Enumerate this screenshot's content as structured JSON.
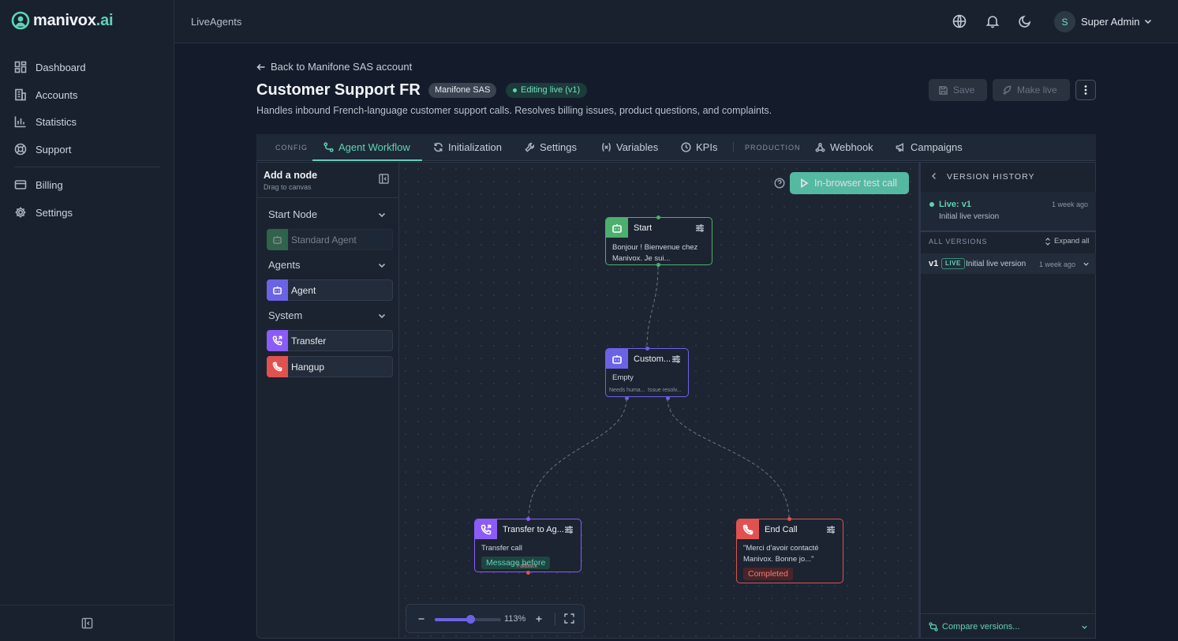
{
  "brand": {
    "name_main": "manivox",
    "name_suffix": ".ai",
    "accent": "#5fd3b6"
  },
  "sidebar": {
    "items": [
      {
        "label": "Dashboard",
        "icon": "dashboard-icon"
      },
      {
        "label": "Accounts",
        "icon": "building-icon"
      },
      {
        "label": "Statistics",
        "icon": "bar-chart-icon"
      },
      {
        "label": "Support",
        "icon": "lifebuoy-icon"
      },
      {
        "label": "Billing",
        "icon": "credit-card-icon"
      },
      {
        "label": "Settings",
        "icon": "gear-icon"
      }
    ]
  },
  "topbar": {
    "breadcrumb": "LiveAgents",
    "user_initial": "S",
    "user_name": "Super Admin"
  },
  "header": {
    "back_link": "Back to Manifone SAS account",
    "title": "Customer Support FR",
    "account_badge": "Manifone SAS",
    "status_badge": "Editing live (v1)",
    "description": "Handles inbound French-language customer support calls. Resolves billing issues, product questions, and complaints.",
    "save_label": "Save",
    "make_live_label": "Make live"
  },
  "tabs": {
    "config_section": "CONFIG",
    "production_section": "PRODUCTION",
    "items": [
      {
        "label": "Agent Workflow",
        "active": true
      },
      {
        "label": "Initialization"
      },
      {
        "label": "Settings"
      },
      {
        "label": "Variables"
      },
      {
        "label": "KPIs"
      },
      {
        "label": "Webhook"
      },
      {
        "label": "Campaigns"
      }
    ]
  },
  "node_palette": {
    "title": "Add a node",
    "subtitle": "Drag to canvas",
    "groups": [
      {
        "label": "Start Node",
        "items": [
          {
            "label": "Standard Agent",
            "color": "#4caf6e",
            "disabled": true
          }
        ]
      },
      {
        "label": "Agents",
        "items": [
          {
            "label": "Agent",
            "color": "#6b63e6"
          }
        ]
      },
      {
        "label": "System",
        "items": [
          {
            "label": "Transfer",
            "color": "#8b5cf6"
          },
          {
            "label": "Hangup",
            "color": "#e0524f"
          }
        ]
      }
    ]
  },
  "canvas": {
    "test_call_label": "In-browser test call",
    "zoom_level": "113%",
    "zoom_fraction": 0.54,
    "nodes": {
      "start": {
        "title": "Start",
        "body": "Bonjour ! Bienvenue chez Manivox. Je sui...",
        "color": "#4caf6e"
      },
      "agent": {
        "title": "Custom...",
        "body": "Empty",
        "out_left": "Needs huma...",
        "out_right": "Issue resolv...",
        "color": "#6b63e6"
      },
      "transfer": {
        "title": "Transfer to Ag...",
        "body": "Transfer call",
        "tag": "Message before",
        "fallback": "Fallback",
        "color": "#8b5cf6"
      },
      "end": {
        "title": "End Call",
        "body": "\"Merci d'avoir contacté Manivox. Bonne jo...\"",
        "tag": "Completed",
        "color": "#e0524f"
      }
    }
  },
  "version_history": {
    "title": "VERSION HISTORY",
    "live_label": "Live: v1",
    "live_desc": "Initial live version",
    "live_time": "1 week ago",
    "all_versions": "ALL VERSIONS",
    "expand_all": "Expand all",
    "versions": [
      {
        "name": "v1",
        "badge": "LIVE",
        "desc": "Initial live version",
        "time": "1 week ago"
      }
    ],
    "compare_label": "Compare versions..."
  }
}
